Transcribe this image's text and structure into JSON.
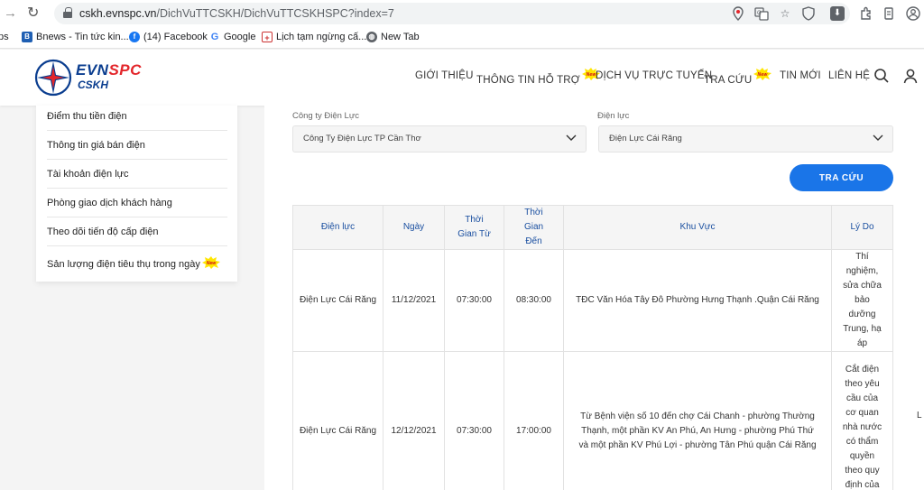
{
  "browser": {
    "url_host": "cskh.evnspc.vn",
    "url_path": "/DichVuTTCSKH/DichVuTTCSKHSPC?index=7",
    "bookmarks": [
      {
        "label": "ps"
      },
      {
        "label": "Bnews - Tin tức kin..."
      },
      {
        "label": "(14) Facebook"
      },
      {
        "label": "Google"
      },
      {
        "label": "Lịch tạm ngừng cấ..."
      },
      {
        "label": "New Tab"
      }
    ]
  },
  "header": {
    "logo_evn": "EVN",
    "logo_spc": "SPC",
    "logo_cskh": "CSKH",
    "nav": [
      {
        "label": "GIỚI THIỆU"
      },
      {
        "label": "THÔNG TIN HỖ TRỢ"
      },
      {
        "label": "DỊCH VỤ TRỰC TUYẾN"
      },
      {
        "label": "TRA CỨU"
      },
      {
        "label": "TIN MỚI"
      },
      {
        "label": "LIÊN HỆ"
      }
    ],
    "new_badge": "New"
  },
  "sidebar": {
    "items": [
      {
        "label": "Điểm thu tiền điện"
      },
      {
        "label": "Thông tin giá bán điện"
      },
      {
        "label": "Tài khoản điện lực"
      },
      {
        "label": "Phòng giao dịch khách hàng"
      },
      {
        "label": "Theo dõi tiến độ cấp điện"
      },
      {
        "label": "Sản lượng điện tiêu thụ trong ngày"
      }
    ]
  },
  "filters": {
    "company_label": "Công ty Điện Lực",
    "company_value": "Công Ty Điện Lực TP Cần Thơ",
    "unit_label": "Điện lực",
    "unit_value": "Điện Lực Cái Răng",
    "search_button": "TRA CỨU"
  },
  "table": {
    "headers": {
      "dien_luc": "Điện lực",
      "ngay": "Ngày",
      "tu": "Thời Gian Từ",
      "den": "Thời Gian Đến",
      "khu_vuc": "Khu Vực",
      "ly_do": "Lý Do"
    },
    "rows": [
      {
        "dien_luc": "Điện Lực Cái Răng",
        "ngay": "11/12/2021",
        "tu": "07:30:00",
        "den": "08:30:00",
        "khu_vuc": "TĐC Văn Hóa Tây Đô Phường Hưng Thạnh .Quận Cái Răng",
        "ly_do": "Thí nghiệm, sửa chữa bảo dưỡng Trung, hạ áp"
      },
      {
        "dien_luc": "Điện Lực Cái Răng",
        "ngay": "12/12/2021",
        "tu": "07:30:00",
        "den": "17:00:00",
        "khu_vuc": "Từ Bệnh viện số 10 đến chợ Cái Chanh - phường Thường Thạnh, một phần KV An Phú, An Hưng - phường Phú Thứ và một phần KV Phú Lợi - phường Tân Phú quận Cái Răng",
        "ly_do": "Cắt điện theo yêu cầu của cơ quan nhà nước có thẩm quyền theo quy định của pháp"
      }
    ]
  },
  "edge_char": "L"
}
